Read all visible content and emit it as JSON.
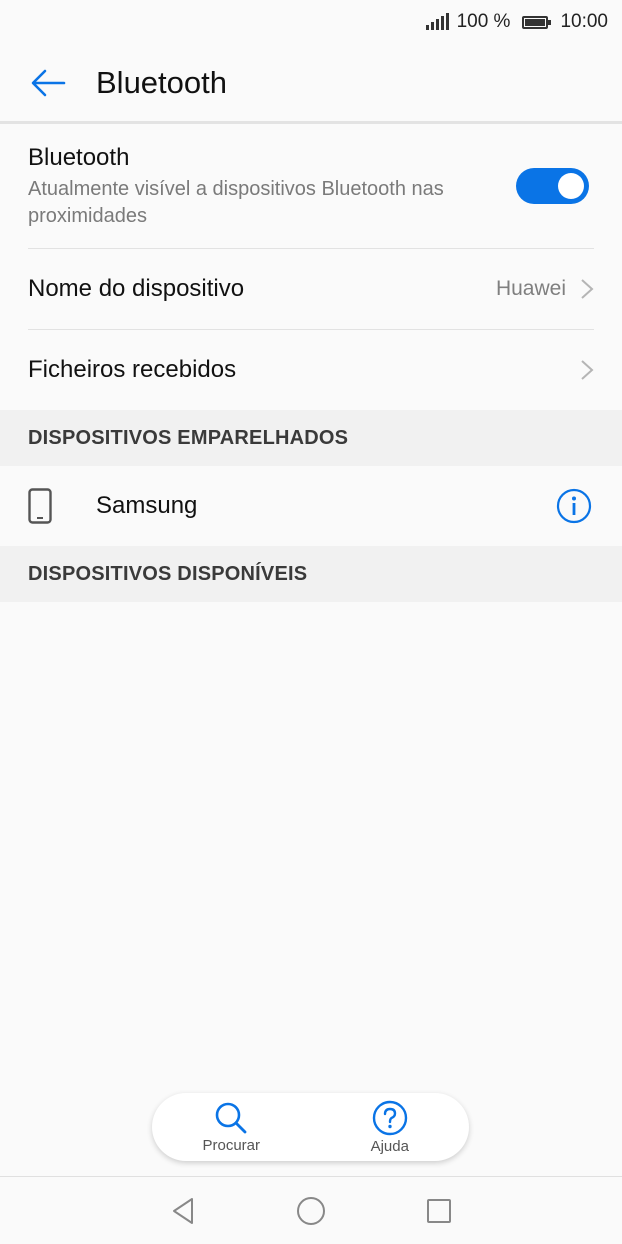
{
  "status_bar": {
    "battery_text": "100 %",
    "time": "10:00"
  },
  "header": {
    "title": "Bluetooth",
    "back_icon": "arrow-left-icon"
  },
  "bluetooth": {
    "title": "Bluetooth",
    "subtitle": "Atualmente visível a dispositivos Bluetooth nas proximidades",
    "enabled": true,
    "accent_color": "#0a74e6"
  },
  "device_name": {
    "label": "Nome do dispositivo",
    "value": "Huawei"
  },
  "received_files": {
    "label": "Ficheiros recebidos"
  },
  "paired_section": {
    "heading": "DISPOSITIVOS EMPARELHADOS",
    "devices": [
      {
        "name": "Samsung",
        "icon": "phone-icon",
        "action_icon": "info-icon"
      }
    ]
  },
  "available_section": {
    "heading": "DISPOSITIVOS DISPONÍVEIS"
  },
  "bottom_actions": {
    "search_label": "Procurar",
    "help_label": "Ajuda"
  },
  "nav_bar": {
    "back_icon": "triangle-back-icon",
    "home_icon": "circle-home-icon",
    "recents_icon": "square-recents-icon"
  }
}
